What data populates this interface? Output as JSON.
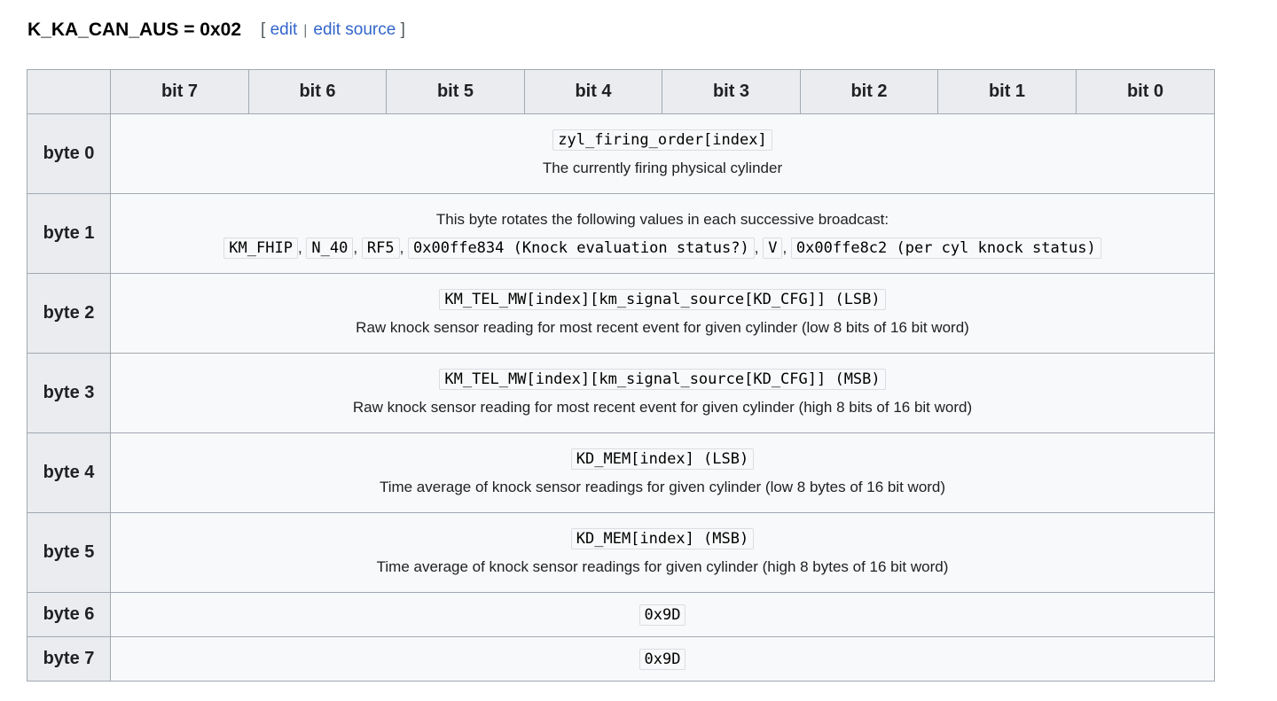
{
  "heading": {
    "title": "K_KA_CAN_AUS = 0x02",
    "bracket_open": "[",
    "edit_label": "edit",
    "separator": "|",
    "edit_source_label": "edit source",
    "bracket_close": "]"
  },
  "table": {
    "corner": "",
    "columns": [
      "bit 7",
      "bit 6",
      "bit 5",
      "bit 4",
      "bit 3",
      "bit 2",
      "bit 1",
      "bit 0"
    ],
    "rows": {
      "byte0": {
        "label": "byte 0",
        "code": "zyl_firing_order[index]",
        "desc": "The currently firing physical cylinder"
      },
      "byte1": {
        "label": "byte 1",
        "desc": "This byte rotates the following values in each successive broadcast:",
        "values": [
          "KM_FHIP",
          "N_40",
          "RF5",
          "0x00ffe834 (Knock evaluation status?)",
          "V",
          "0x00ffe8c2 (per cyl knock status)"
        ],
        "separator": ","
      },
      "byte2": {
        "label": "byte 2",
        "code": "KM_TEL_MW[index][km_signal_source[KD_CFG]] (LSB)",
        "desc": "Raw knock sensor reading for most recent event for given cylinder (low 8 bits of 16 bit word)"
      },
      "byte3": {
        "label": "byte 3",
        "code": "KM_TEL_MW[index][km_signal_source[KD_CFG]] (MSB)",
        "desc": "Raw knock sensor reading for most recent event for given cylinder (high 8 bits of 16 bit word)"
      },
      "byte4": {
        "label": "byte 4",
        "code": "KD_MEM[index] (LSB)",
        "desc": "Time average of knock sensor readings for given cylinder (low 8 bytes of 16 bit word)"
      },
      "byte5": {
        "label": "byte 5",
        "code": "KD_MEM[index] (MSB)",
        "desc": "Time average of knock sensor readings for given cylinder (high 8 bytes of 16 bit word)"
      },
      "byte6": {
        "label": "byte 6",
        "code": "0x9D"
      },
      "byte7": {
        "label": "byte 7",
        "code": "0x9D"
      }
    }
  }
}
